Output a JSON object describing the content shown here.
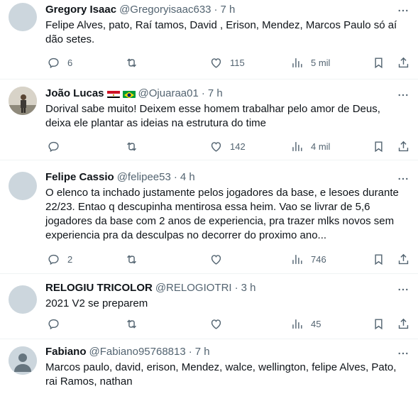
{
  "tweets": [
    {
      "name": "Gregory Isaac",
      "handle": "@Gregoryisaac633",
      "time": "7 h",
      "text": "Felipe Alves, pato, Raí tamos, David , Erison, Mendez, Marcos Paulo só aí dão setes.",
      "replies": "6",
      "retweets": "",
      "likes": "115",
      "views": "5 mil",
      "avatar": "plain-gray"
    },
    {
      "name": "João Lucas",
      "handle": "@Ojuaraa01",
      "time": "7 h",
      "flags": [
        "flag-egypt-icon",
        "flag-brazil-icon"
      ],
      "text": "Dorival sabe muito! Deixem esse homem trabalhar pelo amor de Deus, deixa ele plantar as ideias na estrutura do time",
      "replies": "",
      "retweets": "",
      "likes": "142",
      "views": "4 mil",
      "avatar": "photo"
    },
    {
      "name": "Felipe Cassio",
      "handle": "@felipee53",
      "time": "4 h",
      "text": "O elenco ta inchado justamente pelos jogadores da base, e lesoes durante 22/23. Entao q descupinha mentirosa essa heim. Vao se livrar de 5,6 jogadores da base com 2 anos de experiencia, pra trazer mlks novos sem experiencia pra da desculpas no decorrer do proximo ano...",
      "replies": "2",
      "retweets": "",
      "likes": "",
      "views": "746",
      "avatar": "plain-gray"
    },
    {
      "name": "RELOGIU TRICOLOR",
      "handle": "@RELOGIOTRI",
      "time": "3 h",
      "text": "2021 V2 se preparem",
      "replies": "",
      "retweets": "",
      "likes": "",
      "views": "45",
      "avatar": "plain-gray"
    },
    {
      "name": "Fabiano",
      "handle": "@Fabiano95768813",
      "time": "7 h",
      "text": "Marcos paulo, david, erison, Mendez, walce, wellington, felipe Alves, Pato, rai Ramos, nathan",
      "avatar": "default-person"
    }
  ],
  "separator": "·",
  "colors": {
    "text": "#0f1419",
    "secondary": "#536471",
    "divider": "#eff3f4",
    "avatar": "#ccd6dd"
  },
  "icons": [
    "more-icon",
    "reply-icon",
    "retweet-icon",
    "like-icon",
    "views-icon",
    "bookmark-icon",
    "share-icon"
  ]
}
